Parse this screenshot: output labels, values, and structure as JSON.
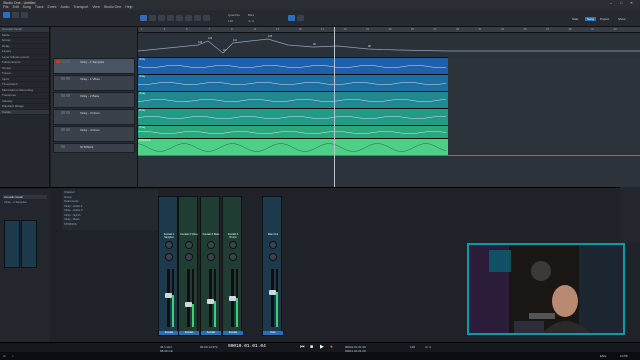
{
  "window": {
    "title": "Studio One - Untitled",
    "min": "–",
    "max": "□",
    "close": "✕"
  },
  "menu": [
    "File",
    "Edit",
    "Song",
    "Track",
    "Event",
    "Audio",
    "Transport",
    "View",
    "Studio One",
    "Help"
  ],
  "toolbar": {
    "tempo": "120",
    "sig": "4 / 4",
    "snap": "Quantize",
    "timebase": "Bars",
    "start": "Start",
    "song": "Song",
    "project": "Project",
    "show": "Show"
  },
  "inspector": {
    "track_name": "Acoustic Guitar",
    "rows": [
      "Mode",
      "Group",
      "Delay",
      "Layers",
      "Layer follows events",
      "Follow Events",
      "Tempo",
      "Tuned",
      "Input",
      "Timestretch",
      "Microsphere Recording",
      "Transpose",
      "Velocity",
      "Playback Range",
      "Vocals"
    ]
  },
  "tracks": [
    {
      "name": "Vinky - 1 Samples",
      "selected": true
    },
    {
      "name": "Vinky - 1 Vibes",
      "selected": false
    },
    {
      "name": "Vinky - 2 Bass",
      "selected": false
    },
    {
      "name": "Vinky - 3 Drum",
      "selected": false
    },
    {
      "name": "Vinky - 4 Drum",
      "selected": false
    },
    {
      "name": "STRINGS",
      "selected": false
    }
  ],
  "ruler": [
    "1",
    "3",
    "5",
    "7",
    "9",
    "11",
    "13",
    "15",
    "17",
    "19",
    "21",
    "23",
    "25",
    "27",
    "29",
    "31",
    "33",
    "35",
    "37",
    "39",
    "41",
    "43"
  ],
  "tempo_points": [
    "120",
    "100",
    "92",
    "110",
    "105",
    "96",
    "88"
  ],
  "lanes": [
    {
      "label": "Vinky",
      "color": "#1e5fa8"
    },
    {
      "label": "Vinky",
      "color": "#1e6fa0"
    },
    {
      "label": "Vinky",
      "color": "#1f8890"
    },
    {
      "label": "Vinky",
      "color": "#229a86"
    },
    {
      "label": "Vinky",
      "color": "#2aa87a"
    },
    {
      "label": "STRINGS",
      "color": "#4ecf86"
    }
  ],
  "routing": [
    "Channel",
    "Group",
    "Instruments",
    "Vinky - Audio 1",
    "Vinky - Audio 2",
    "Vinky - Synth",
    "Vinky - Bass",
    "STRINGS"
  ],
  "channels": [
    {
      "name": "Kontakt",
      "label": "Kontakt 1 Samples",
      "level": 0.55,
      "color": "blue"
    },
    {
      "name": "Kontakt",
      "label": "Kontakt 2 Vibes",
      "level": 0.4,
      "color": "green"
    },
    {
      "name": "Kontakt",
      "label": "Kontakt 3 Bass",
      "level": 0.45,
      "color": "green"
    },
    {
      "name": "Kontakt",
      "label": "Kontakt 4 Drums",
      "level": 0.5,
      "color": "green"
    },
    {
      "name": "Main",
      "label": "Main Out",
      "level": 0.6,
      "color": "blue"
    }
  ],
  "left_channel": {
    "name": "Acoustic Guitar",
    "sub": "Vinky - 1 Samples"
  },
  "transport": {
    "sample_rate": "44.1 kHz",
    "length": "98:30 min",
    "time": "00010.01.01.04",
    "tempo": "120",
    "sig": "4 / 4",
    "pos": "00:03:14.572",
    "loop_start": "00001.01.01.00",
    "loop_end": "00011.01.01.00"
  },
  "taskbar": {
    "clock": "10:58",
    "lang": "ENG"
  }
}
